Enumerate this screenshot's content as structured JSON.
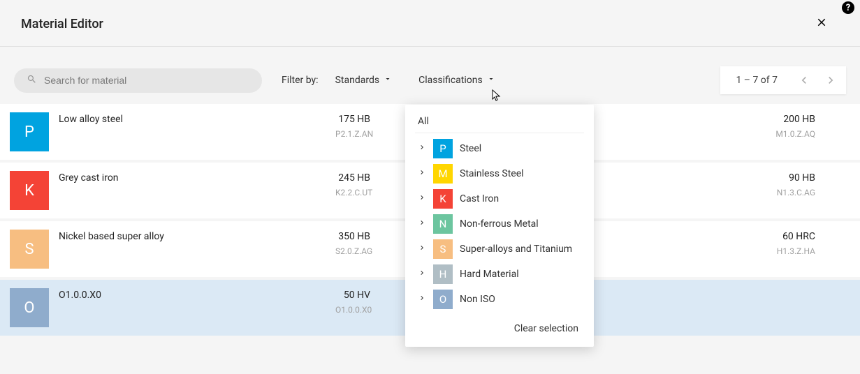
{
  "header": {
    "title": "Material Editor"
  },
  "toolbar": {
    "search_placeholder": "Search for material",
    "filter_by_label": "Filter by:",
    "standards_label": "Standards",
    "classifications_label": "Classifications",
    "pager_text": "1 – 7 of 7"
  },
  "chip_colors": {
    "P": "#00a3e0",
    "K": "#f44336",
    "S": "#f7be81",
    "O": "#8faccc",
    "M": "#ffd600",
    "N": "#6cc59f",
    "H": "#b0bec5"
  },
  "rows": [
    {
      "letter": "P",
      "name": "Low alloy steel",
      "metric": "175 HB",
      "code": "P2.1.Z.AN",
      "right_metric": "200 HB",
      "right_code": "M1.0.Z.AQ",
      "selected": false
    },
    {
      "letter": "K",
      "name": "Grey cast iron",
      "metric": "245 HB",
      "code": "K2.2.C.UT",
      "right_metric": "90 HB",
      "right_code": "N1.3.C.AG",
      "selected": false
    },
    {
      "letter": "S",
      "name": "Nickel based super alloy",
      "metric": "350 HB",
      "code": "S2.0.Z.AG",
      "right_metric": "60 HRC",
      "right_code": "H1.3.Z.HA",
      "selected": false
    },
    {
      "letter": "O",
      "name": "O1.0.0.X0",
      "metric": "50 HV",
      "code": "O1.0.0.X0",
      "right_metric": "",
      "right_code": "",
      "selected": true
    }
  ],
  "popup": {
    "all_label": "All",
    "clear_label": "Clear selection",
    "items": [
      {
        "letter": "P",
        "label": "Steel"
      },
      {
        "letter": "M",
        "label": "Stainless Steel"
      },
      {
        "letter": "K",
        "label": "Cast Iron"
      },
      {
        "letter": "N",
        "label": "Non-ferrous Metal"
      },
      {
        "letter": "S",
        "label": "Super-alloys and Titanium"
      },
      {
        "letter": "H",
        "label": "Hard Material"
      },
      {
        "letter": "O",
        "label": "Non ISO"
      }
    ]
  }
}
